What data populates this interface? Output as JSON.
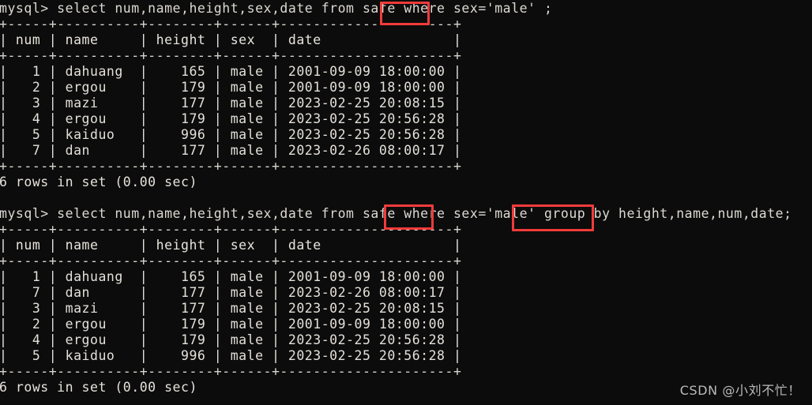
{
  "terminal": {
    "background_color": "#0c0c0c",
    "text_color": "#e6e2dc",
    "highlight_color": "#f23b3b"
  },
  "blocks": [
    {
      "prompt": "mysql> select num,name,height,sex,date from safe where sex='male' ;",
      "rule_top": "+-----+----------+--------+------+---------------------+",
      "header": "| num | name     | height | sex  | date                |",
      "rule_mid": "+-----+----------+--------+------+---------------------+",
      "rows": [
        "|   1 | dahuang  |    165 | male | 2001-09-09 18:00:00 |",
        "|   2 | ergou    |    179 | male | 2001-09-09 18:00:00 |",
        "|   3 | mazi     |    177 | male | 2023-02-25 20:08:15 |",
        "|   4 | ergou    |    179 | male | 2023-02-25 20:56:28 |",
        "|   5 | kaiduo   |    996 | male | 2023-02-25 20:56:28 |",
        "|   7 | dan      |    177 | male | 2023-02-26 08:00:17 |"
      ],
      "rule_bottom": "+-----+----------+--------+------+---------------------+",
      "status": "6 rows in set (0.00 sec)"
    },
    {
      "prompt": "mysql> select num,name,height,sex,date from safe where sex='male' group by height,name,num,date;",
      "rule_top": "+-----+----------+--------+------+---------------------+",
      "header": "| num | name     | height | sex  | date                |",
      "rule_mid": "+-----+----------+--------+------+---------------------+",
      "rows": [
        "|   1 | dahuang  |    165 | male | 2001-09-09 18:00:00 |",
        "|   7 | dan      |    177 | male | 2023-02-26 08:00:17 |",
        "|   3 | mazi     |    177 | male | 2023-02-25 20:08:15 |",
        "|   2 | ergou    |    179 | male | 2001-09-09 18:00:00 |",
        "|   4 | ergou    |    179 | male | 2023-02-25 20:56:28 |",
        "|   5 | kaiduo   |    996 | male | 2023-02-25 20:56:28 |"
      ],
      "rule_bottom": "+-----+----------+--------+------+---------------------+",
      "status": "6 rows in set (0.00 sec)"
    }
  ],
  "table_columns": [
    "num",
    "name",
    "height",
    "sex",
    "date"
  ],
  "result_sets": [
    {
      "query_keywords_highlighted": [
        "where"
      ],
      "row_count": 6,
      "elapsed": "0.00 sec",
      "rows": [
        {
          "num": "1",
          "name": "dahuang",
          "height": "165",
          "sex": "male",
          "date": "2001-09-09 18:00:00"
        },
        {
          "num": "2",
          "name": "ergou",
          "height": "179",
          "sex": "male",
          "date": "2001-09-09 18:00:00"
        },
        {
          "num": "3",
          "name": "mazi",
          "height": "177",
          "sex": "male",
          "date": "2023-02-25 20:08:15"
        },
        {
          "num": "4",
          "name": "ergou",
          "height": "179",
          "sex": "male",
          "date": "2023-02-25 20:56:28"
        },
        {
          "num": "5",
          "name": "kaiduo",
          "height": "996",
          "sex": "male",
          "date": "2023-02-25 20:56:28"
        },
        {
          "num": "7",
          "name": "dan",
          "height": "177",
          "sex": "male",
          "date": "2023-02-26 08:00:17"
        }
      ]
    },
    {
      "query_keywords_highlighted": [
        "where",
        "group by"
      ],
      "row_count": 6,
      "elapsed": "0.00 sec",
      "rows": [
        {
          "num": "1",
          "name": "dahuang",
          "height": "165",
          "sex": "male",
          "date": "2001-09-09 18:00:00"
        },
        {
          "num": "7",
          "name": "dan",
          "height": "177",
          "sex": "male",
          "date": "2023-02-26 08:00:17"
        },
        {
          "num": "3",
          "name": "mazi",
          "height": "177",
          "sex": "male",
          "date": "2023-02-25 20:08:15"
        },
        {
          "num": "2",
          "name": "ergou",
          "height": "179",
          "sex": "male",
          "date": "2001-09-09 18:00:00"
        },
        {
          "num": "4",
          "name": "ergou",
          "height": "179",
          "sex": "male",
          "date": "2023-02-25 20:56:28"
        },
        {
          "num": "5",
          "name": "kaiduo",
          "height": "996",
          "sex": "male",
          "date": "2023-02-25 20:56:28"
        }
      ]
    }
  ],
  "annotations": [
    {
      "label": "where",
      "target": "query-1"
    },
    {
      "label": "where",
      "target": "query-2"
    },
    {
      "label": "group by",
      "target": "query-2"
    }
  ],
  "watermark": "CSDN @小刘不忙！"
}
